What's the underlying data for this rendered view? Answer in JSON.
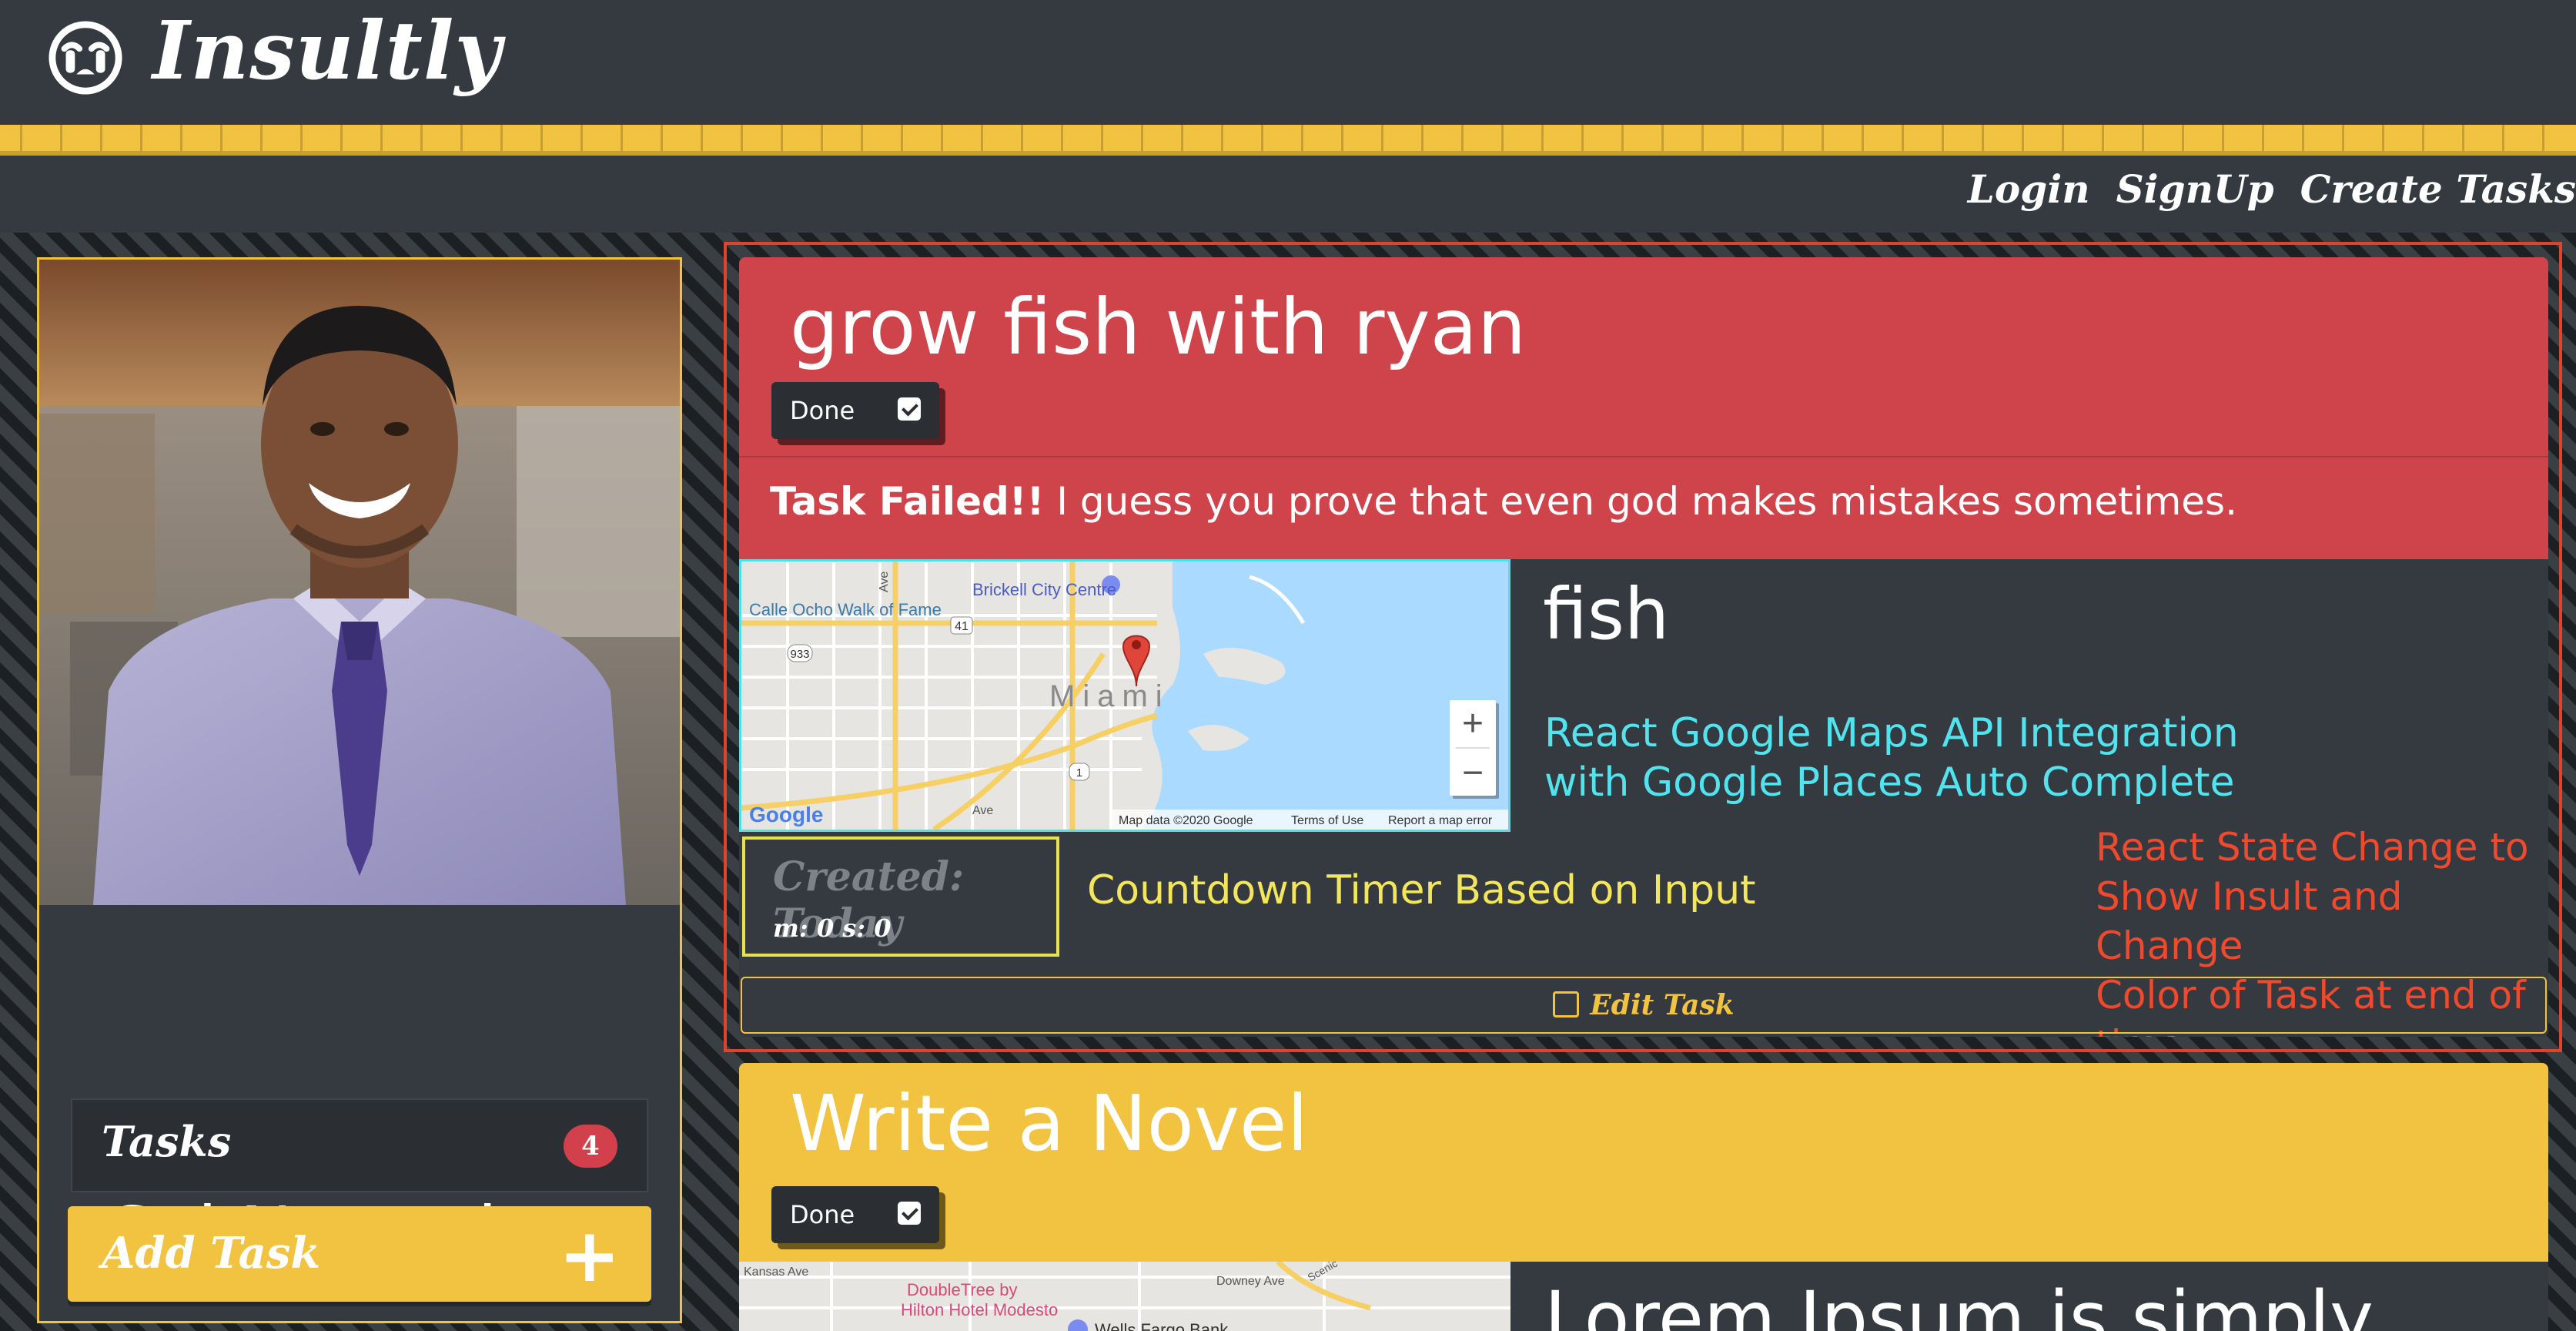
{
  "app": {
    "title": "Insultly",
    "logo_icon": "crying-face-icon"
  },
  "nav": {
    "links": [
      "Login",
      "SignUp",
      "Create Tasks"
    ]
  },
  "profile": {
    "name": "Sai Narendran",
    "tasks_label": "Tasks",
    "tasks_count": "4",
    "add_task_label": "Add Task",
    "add_task_icon": "plus-icon"
  },
  "tasks": [
    {
      "title": "grow fish with ryan",
      "done_label": "Done",
      "status_color": "#cf434b",
      "fail_bold": "Task Failed!!",
      "fail_message": " I guess you prove that even god makes mistakes sometimes.",
      "subtitle": "fish",
      "created_label": "Created: Today",
      "timer": "m: 0 s: 0",
      "edit_label": "Edit Task",
      "map": {
        "city": "Miami",
        "labels": [
          "Brickell City Centre",
          "Calle Ocho Walk of Fame",
          "Ave",
          "41",
          "933",
          "1",
          "Ave"
        ],
        "zoom_in": "+",
        "zoom_out": "−",
        "footer": [
          "Map data ©2020 Google",
          "Terms of Use",
          "Report a map error"
        ],
        "logo": "Google"
      }
    },
    {
      "title": "Write a Novel",
      "done_label": "Done",
      "status_color": "#f2c340",
      "subtitle": "Lorem Ipsum is simply",
      "map": {
        "labels": [
          "Kansas Ave",
          "Downey Ave",
          "Scenic",
          "DoubleTree by",
          "Hilton Hotel Modesto",
          "Wells Fargo Bank"
        ]
      }
    }
  ],
  "annotations": {
    "cyan": [
      "React Google Maps API Integration",
      "with Google Places Auto Complete"
    ],
    "yellow": "Countdown Timer Based on Input",
    "red": [
      "React State Change to",
      "Show Insult and Change",
      "Color of Task at end of",
      "time"
    ]
  },
  "colors": {
    "background": "#343a40",
    "accent_yellow": "#f2c340",
    "failed_red": "#cf434b",
    "annotation_cyan": "#52e4ee",
    "annotation_yellow": "#f4e65a",
    "annotation_red": "#ef4a2e"
  }
}
